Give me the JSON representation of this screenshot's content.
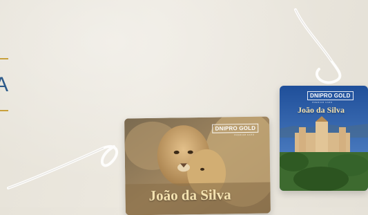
{
  "left_title": {
    "text": "A"
  },
  "cards": [
    {
      "id": "lion",
      "brand": "DNIPRO GOLD",
      "brand_sub": "PREMIUM CARD",
      "holder": "João da Silva"
    },
    {
      "id": "palace",
      "brand": "DNIPRO GOLD",
      "brand_sub": "PREMIUM CARD",
      "holder": "João da Silva"
    }
  ],
  "colors": {
    "gold": "#c8a03c",
    "title_blue": "#2d5a8a",
    "name_gold": "#f4e2b0",
    "sky": "#2a5ea8"
  }
}
